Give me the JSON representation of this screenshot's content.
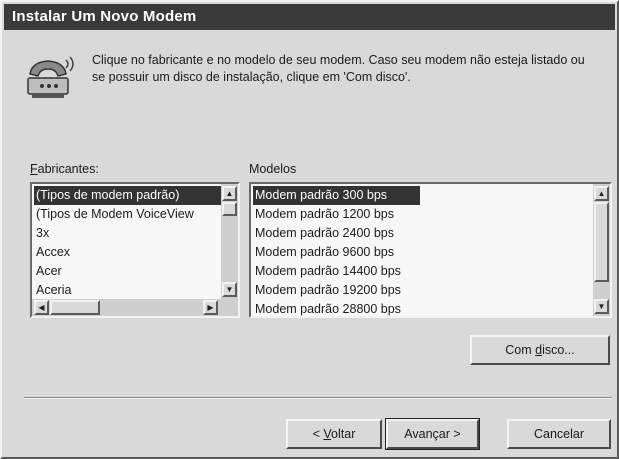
{
  "window": {
    "title": "Instalar Um Novo Modem"
  },
  "intro": {
    "icon": "modem-phone-icon",
    "text": "Clique no fabricante e no modelo de seu modem. Caso seu modem não esteja listado ou se possuir um disco de instalação, clique em 'Com disco'."
  },
  "manufacturers": {
    "label_underlined": "F",
    "label_rest": "abricantes:",
    "items": [
      "(Tipos de modem padrão)",
      "(Tipos de Modem VoiceView",
      "3x",
      "Accex",
      "Acer",
      "Aceria"
    ],
    "selected_index": 0
  },
  "models": {
    "label": "Modelos",
    "items": [
      "Modem padrão  300 bps",
      "Modem padrão  1200 bps",
      "Modem padrão  2400 bps",
      "Modem padrão  9600 bps",
      "Modem padrão 14400 bps",
      "Modem padrão 19200 bps",
      "Modem padrão 28800 bps"
    ],
    "selected_index": 0
  },
  "buttons": {
    "have_disk_prefix": "Com ",
    "have_disk_underlined": "d",
    "have_disk_suffix": "isco...",
    "back_prefix": "< ",
    "back_underlined": "V",
    "back_suffix": "oltar",
    "next": "Avançar >",
    "cancel": "Cancelar"
  }
}
